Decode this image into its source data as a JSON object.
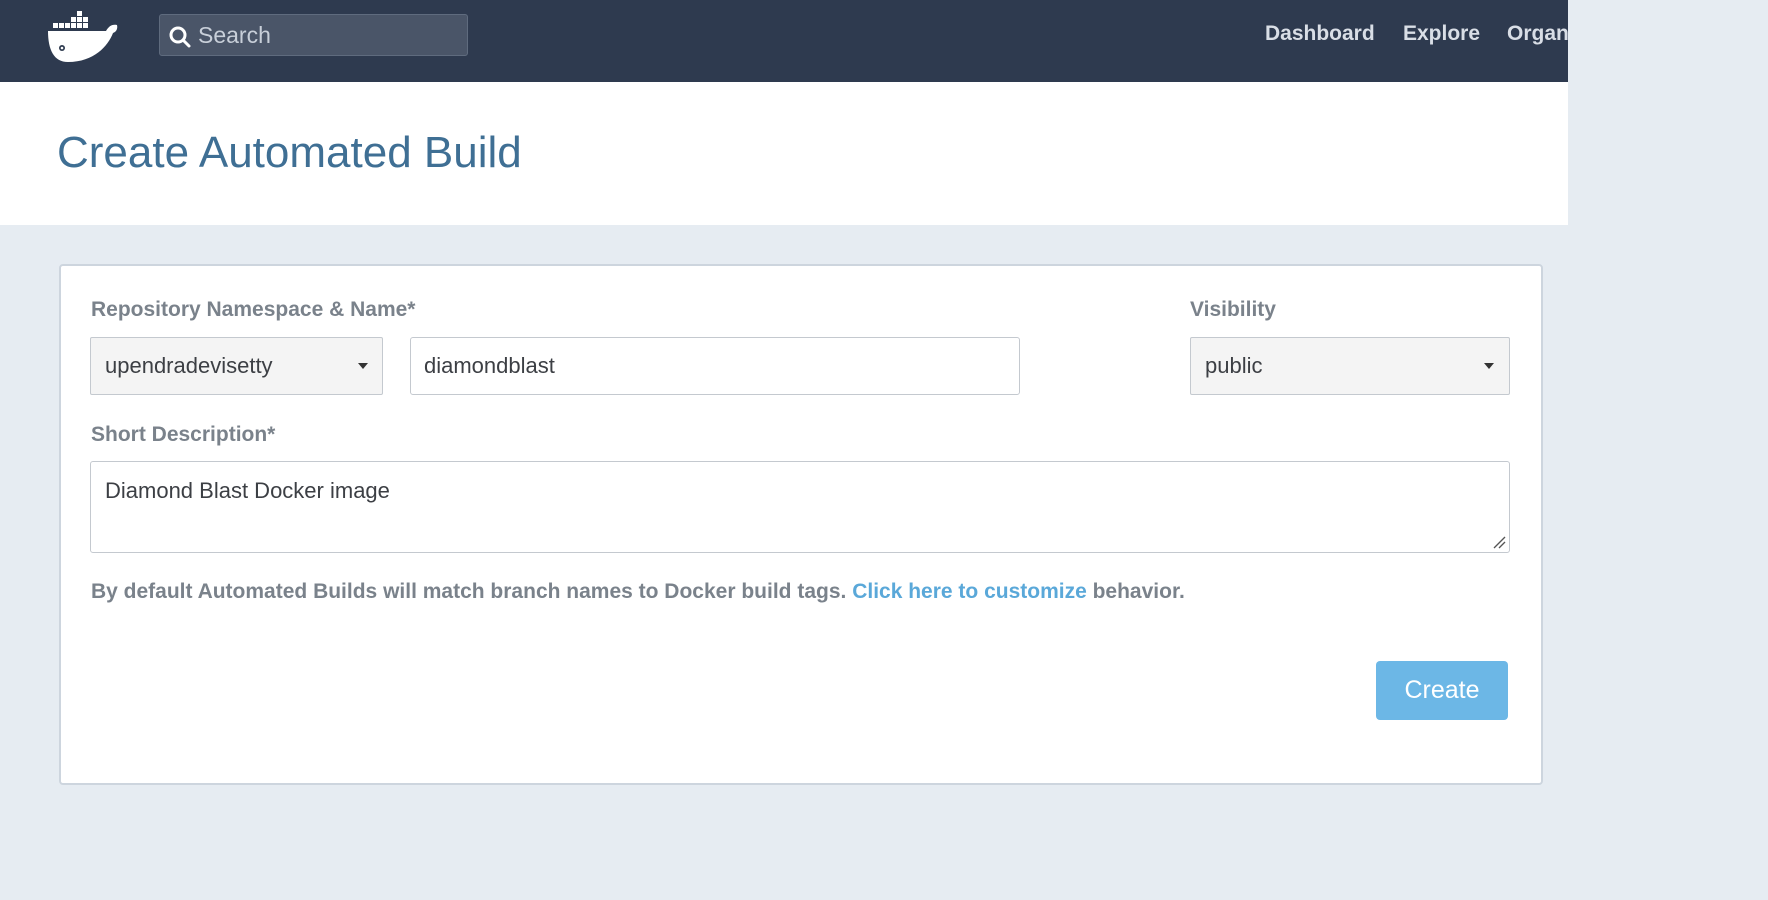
{
  "header": {
    "logo_icon": "docker-whale-icon",
    "search": {
      "placeholder": "Search",
      "value": ""
    },
    "nav": [
      {
        "label": "Dashboard"
      },
      {
        "label": "Explore"
      },
      {
        "label": "Organ"
      }
    ]
  },
  "page": {
    "title": "Create Automated Build"
  },
  "form": {
    "repo_label": "Repository Namespace & Name*",
    "namespace_value": "upendradevisetty",
    "name_value": "diamondblast",
    "visibility_label": "Visibility",
    "visibility_value": "public",
    "description_label": "Short Description*",
    "description_value": "Diamond Blast Docker image",
    "info_prefix": "By default Automated Builds will match branch names to Docker build tags. ",
    "info_link": "Click here to customize",
    "info_suffix": " behavior.",
    "create_label": "Create"
  },
  "colors": {
    "topbar": "#2e3a4f",
    "title": "#3f6f94",
    "link": "#5aa8d9",
    "button": "#6cb7e6",
    "page_bg": "#e6ecf2"
  }
}
